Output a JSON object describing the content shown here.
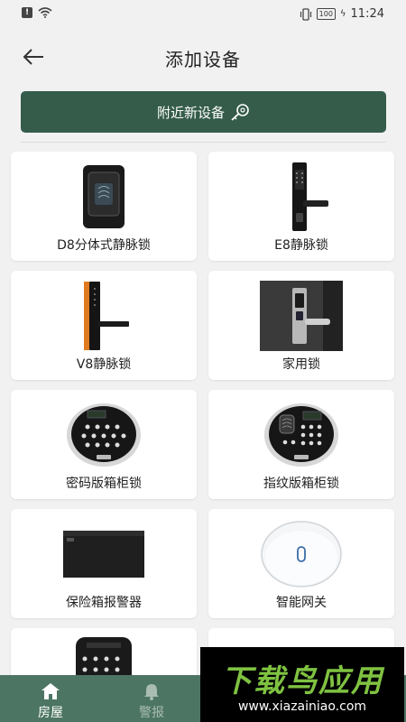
{
  "status_bar": {
    "time": "11:24",
    "battery": "100"
  },
  "header": {
    "title": "添加设备"
  },
  "nearby": {
    "label": "附近新设备"
  },
  "devices": [
    {
      "label": "D8分体式静脉锁",
      "icon": "d8-lock"
    },
    {
      "label": "E8静脉锁",
      "icon": "e8-lock"
    },
    {
      "label": "V8静脉锁",
      "icon": "v8-lock"
    },
    {
      "label": "家用锁",
      "icon": "home-lock"
    },
    {
      "label": "密码版箱柜锁",
      "icon": "keypad-cabinet-lock"
    },
    {
      "label": "指纹版箱柜锁",
      "icon": "fingerprint-cabinet-lock"
    },
    {
      "label": "保险箱报警器",
      "icon": "safe-alarm"
    },
    {
      "label": "智能网关",
      "icon": "smart-gateway"
    },
    {
      "label": "",
      "icon": "keypad-device"
    },
    {
      "label": "",
      "icon": "round-device"
    }
  ],
  "tabs": [
    {
      "label": "房屋",
      "icon": "house-icon",
      "active": true
    },
    {
      "label": "警报",
      "icon": "bell-icon",
      "active": false
    }
  ],
  "watermark": {
    "title": "下载鸟应用",
    "url": "www.xiazainiao.com"
  },
  "colors": {
    "primary": "#355c4b",
    "tabbar": "#4d7564",
    "watermark_green": "#7fc241"
  }
}
